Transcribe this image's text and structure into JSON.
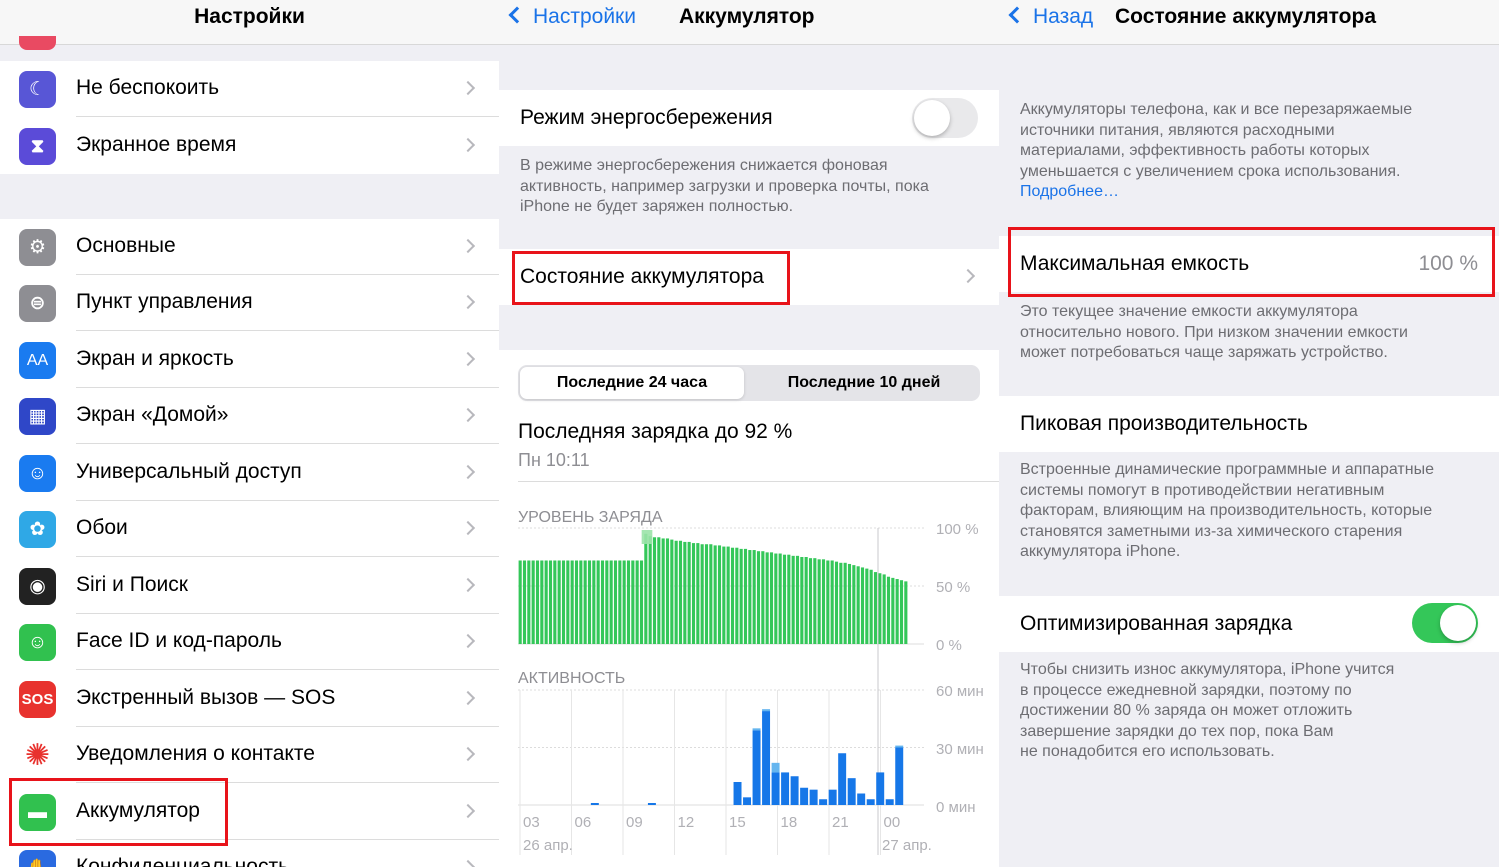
{
  "colors": {
    "accent": "#1a73e8",
    "green": "#34c759",
    "red_highlight": "#e8131a",
    "bar_blue": "#1677e8",
    "bar_light_blue": "#64b5ef"
  },
  "settings": {
    "title": "Настройки",
    "items": [
      {
        "label": "Не беспокоить",
        "icon": "moon-icon",
        "color": "#5856d6"
      },
      {
        "label": "Экранное время",
        "icon": "hourglass-icon",
        "color": "#5b4bd8"
      },
      {
        "label": "Основные",
        "icon": "gear-icon",
        "color": "#8e8e93"
      },
      {
        "label": "Пункт управления",
        "icon": "toggles-icon",
        "color": "#8e8e93"
      },
      {
        "label": "Экран и яркость",
        "icon": "aa-icon",
        "color": "#1a7bf0"
      },
      {
        "label": "Экран «Домой»",
        "icon": "home-grid-icon",
        "color": "#2f47c8"
      },
      {
        "label": "Универсальный доступ",
        "icon": "accessibility-icon",
        "color": "#1a7bf0"
      },
      {
        "label": "Обои",
        "icon": "flower-icon",
        "color": "#2fa8e6"
      },
      {
        "label": "Siri и Поиск",
        "icon": "siri-icon",
        "color": "#222"
      },
      {
        "label": "Face ID и код-пароль",
        "icon": "faceid-icon",
        "color": "#31c14f"
      },
      {
        "label": "Экстренный вызов — SOS",
        "icon": "sos-icon",
        "color": "#e8322e"
      },
      {
        "label": "Уведомления о контакте",
        "icon": "exposure-icon",
        "color": "#ffffff"
      },
      {
        "label": "Аккумулятор",
        "icon": "battery-icon",
        "color": "#31c14f"
      },
      {
        "label": "Конфиденциальность",
        "icon": "hand-icon",
        "color": "#2a6ae0"
      }
    ],
    "sos_text": "SOS",
    "aa_text": "AA"
  },
  "battery": {
    "back": "Настройки",
    "title": "Аккумулятор",
    "low_power_label": "Режим энергосбережения",
    "low_power_on": false,
    "low_power_footer": [
      "В режиме энергосбережения снижается фоновая",
      "активность, например загрузки и проверка почты, пока",
      "iPhone не будет заряжен полностью."
    ],
    "health_link": "Состояние аккумулятора",
    "tabs": [
      "Последние 24 часа",
      "Последние 10 дней"
    ],
    "selected_tab": 0,
    "last_charge": "Последняя зарядка до 92 %",
    "last_charge_time": "Пн 10:11"
  },
  "chart_data": [
    {
      "type": "bar",
      "title": "УРОВЕНЬ ЗАРЯДА",
      "ylim": [
        0,
        100
      ],
      "y_ticks": [
        "100 %",
        "50 %",
        "0 %"
      ],
      "values": [
        72,
        72,
        72,
        72,
        72,
        72,
        72,
        72,
        72,
        72,
        72,
        72,
        72,
        72,
        72,
        72,
        72,
        72,
        72,
        72,
        72,
        72,
        72,
        72,
        72,
        72,
        72,
        72,
        72,
        95,
        93,
        92,
        92,
        91,
        91,
        90,
        89,
        89,
        88,
        88,
        87,
        87,
        86,
        86,
        86,
        85,
        85,
        84,
        84,
        83,
        83,
        82,
        82,
        81,
        81,
        80,
        80,
        79,
        79,
        78,
        78,
        77,
        77,
        76,
        76,
        75,
        75,
        74,
        74,
        73,
        73,
        72,
        72,
        71,
        70,
        70,
        69,
        68,
        67,
        66,
        65,
        64,
        62,
        61,
        60,
        58,
        57,
        56,
        55,
        54
      ]
    },
    {
      "type": "bar",
      "title": "АКТИВНОСТЬ",
      "ylim": [
        0,
        60
      ],
      "y_ticks": [
        "60 мин",
        "30 мин",
        "0 мин"
      ],
      "x_ticks": [
        "03",
        "06",
        "09",
        "12",
        "15",
        "18",
        "21",
        "00"
      ],
      "x_sub": [
        "26 апр.",
        "27 апр."
      ],
      "screen_on": [
        0,
        0,
        0,
        0,
        0,
        0,
        0,
        0,
        0,
        0,
        0,
        0,
        0,
        0,
        0,
        0,
        0,
        0,
        0,
        0,
        0,
        0,
        12,
        4,
        39,
        49,
        17,
        17,
        15,
        9,
        8,
        3,
        8,
        27,
        14,
        6,
        3,
        17,
        3,
        30,
        0
      ],
      "screen_off": [
        0,
        0,
        0,
        0,
        0,
        0,
        0,
        0,
        0,
        0,
        0,
        0,
        0,
        0,
        0,
        0,
        0,
        0,
        0,
        0,
        0,
        0,
        0,
        0,
        1,
        1,
        5,
        0,
        0,
        0,
        0,
        0,
        0,
        0,
        0,
        0,
        0,
        0,
        0,
        1,
        0
      ],
      "tiny": [
        0,
        0,
        0,
        0,
        0,
        0,
        0,
        1,
        0,
        0,
        0,
        0,
        0,
        1,
        0,
        0,
        0,
        0,
        0,
        0,
        0,
        0,
        0,
        0,
        0,
        0,
        0,
        0,
        0,
        0,
        0,
        0,
        0,
        0,
        0,
        0,
        0,
        0,
        0,
        0,
        0
      ]
    }
  ],
  "health": {
    "back": "Назад",
    "title": "Состояние аккумулятора",
    "intro": [
      "Аккумуляторы телефона, как и все перезаряжаемые",
      "источники питания, являются расходными",
      "материалами, эффективность работы которых",
      "уменьшается с увеличением срока использования."
    ],
    "more_link": "Подробнее…",
    "max_capacity_label": "Максимальная емкость",
    "max_capacity_value": "100 %",
    "capacity_footer": [
      "Это текущее значение емкости аккумулятора",
      "относительно нового. При низком значении емкости",
      "может потребоваться чаще заряжать устройство."
    ],
    "peak_label": "Пиковая производительность",
    "peak_footer": [
      "Встроенные динамические программные и аппаратные",
      "системы помогут в противодействии негативным",
      "факторам, влияющим на производительность, которые",
      "становятся заметными из-за химического старения",
      "аккумулятора iPhone."
    ],
    "optimized_label": "Оптимизированная зарядка",
    "optimized_on": true,
    "optimized_footer": [
      "Чтобы снизить износ аккумулятора, iPhone учится",
      "в процессе ежедневной зарядки, поэтому по",
      "достижении 80 % заряда он может отложить",
      "завершение зарядки до тех пор, пока Вам",
      "не понадобится его использовать."
    ]
  }
}
